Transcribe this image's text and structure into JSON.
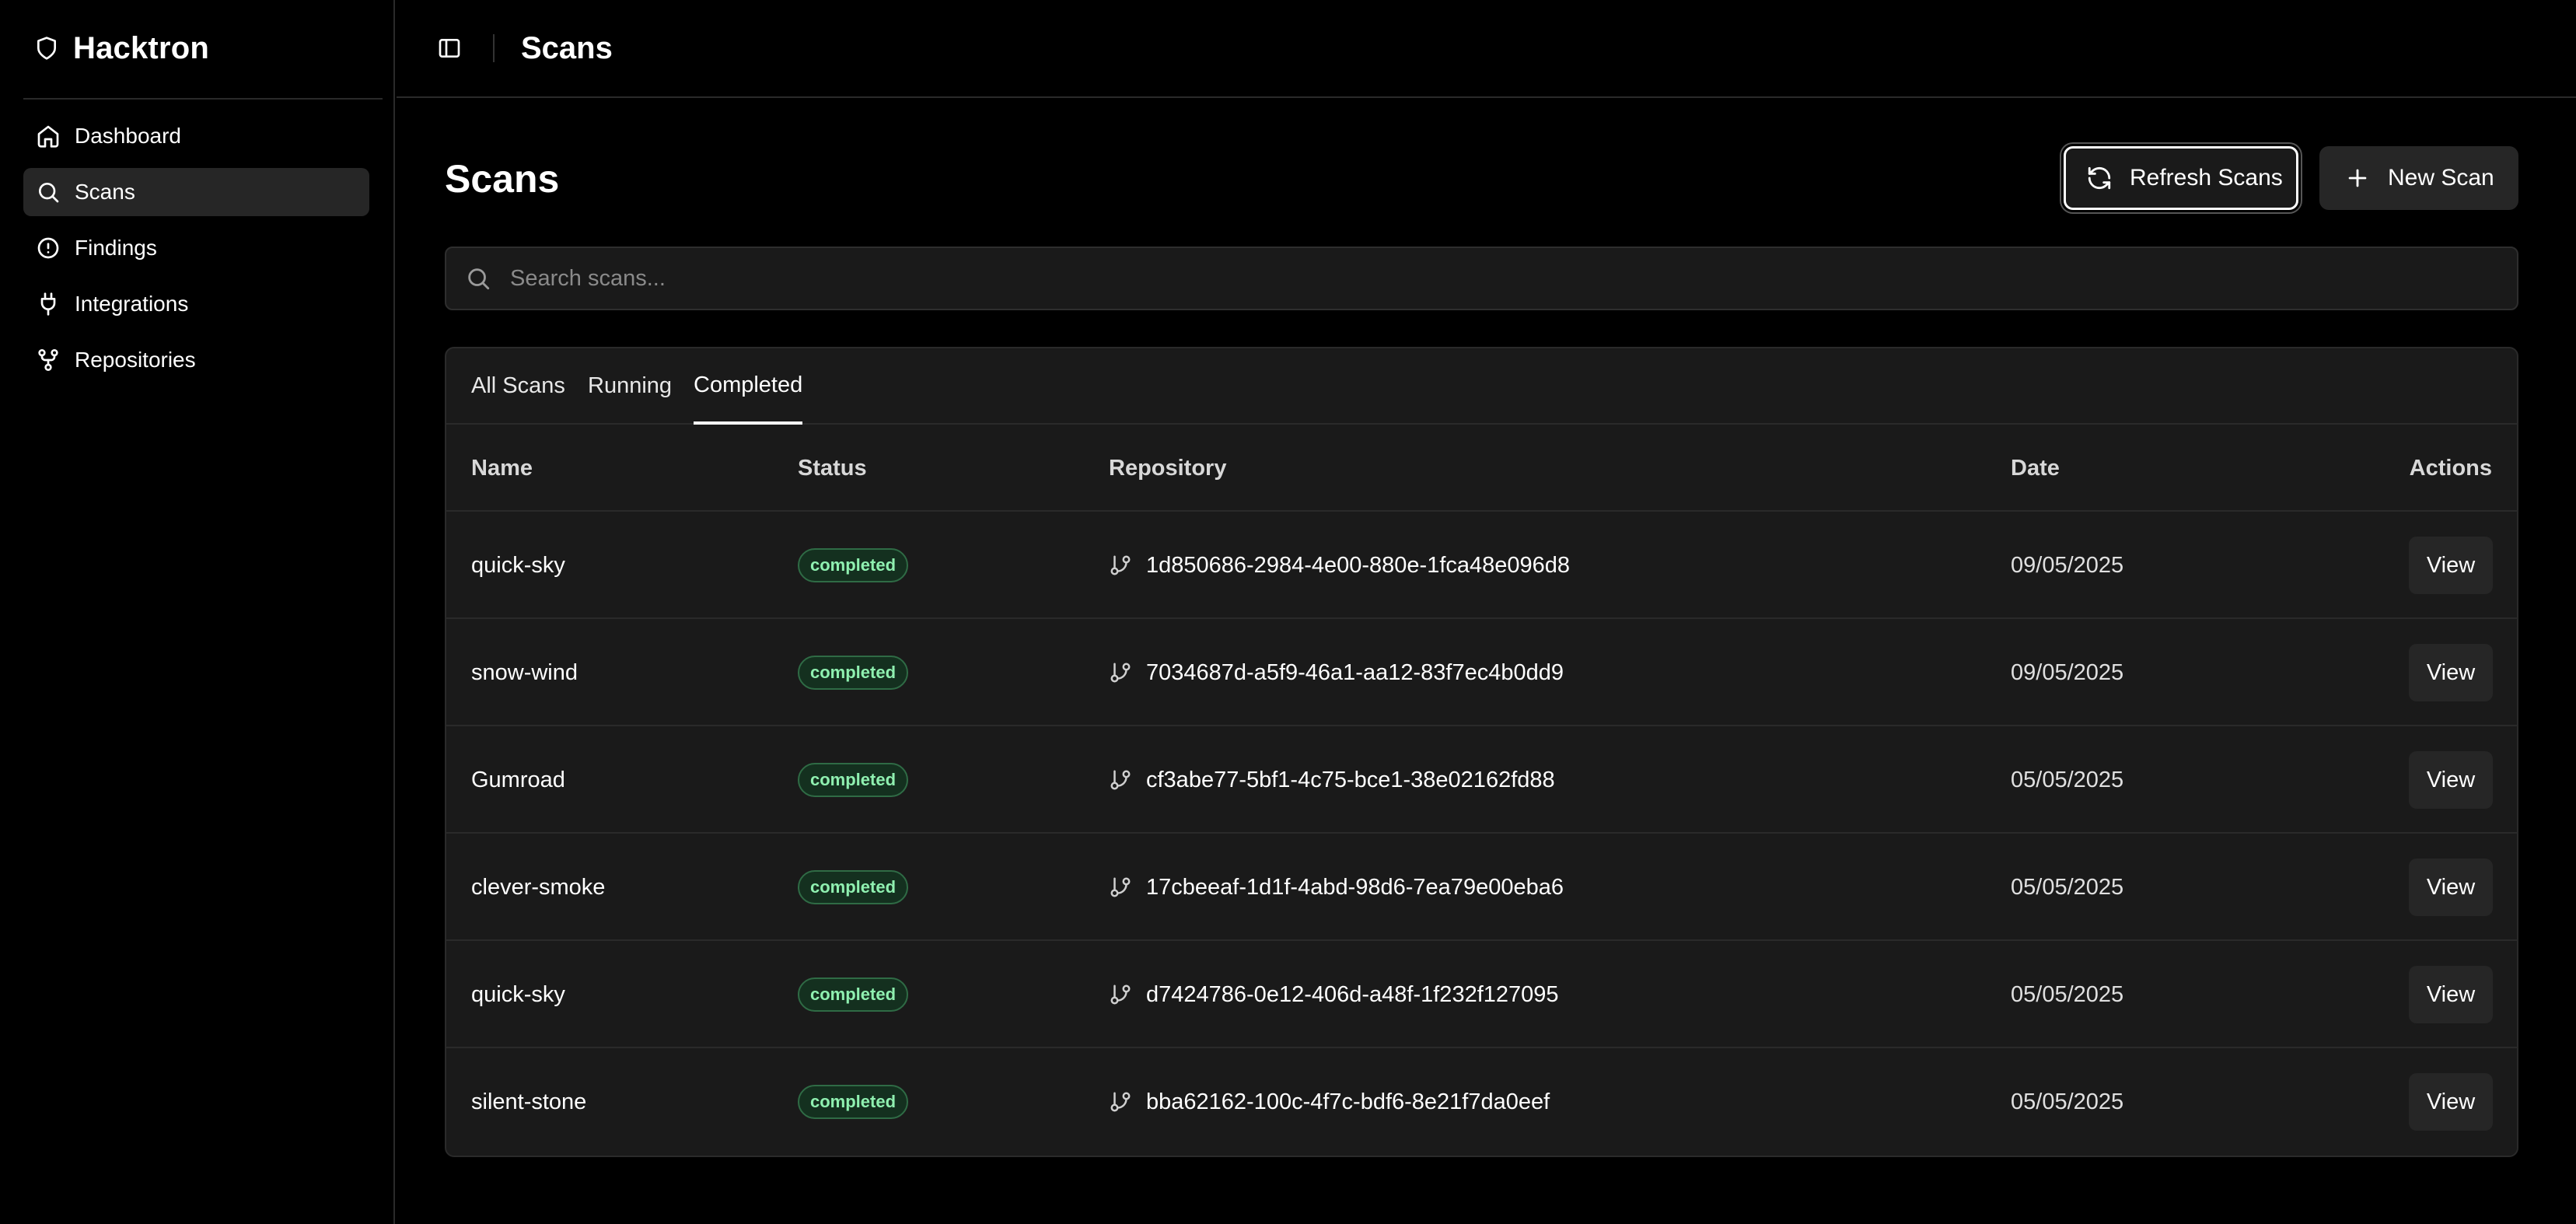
{
  "app": {
    "name": "Hacktron",
    "logo_icon": "shield-icon"
  },
  "sidebar": {
    "items": [
      {
        "label": "Dashboard",
        "icon": "home-icon",
        "active": false
      },
      {
        "label": "Scans",
        "icon": "search-icon",
        "active": true
      },
      {
        "label": "Findings",
        "icon": "alert-circle-icon",
        "active": false
      },
      {
        "label": "Integrations",
        "icon": "plug-icon",
        "active": false
      },
      {
        "label": "Repositories",
        "icon": "git-fork-icon",
        "active": false
      }
    ]
  },
  "header": {
    "title": "Scans",
    "toggle_icon": "panel-left-icon"
  },
  "main": {
    "title": "Scans",
    "refresh_label": "Refresh Scans",
    "new_scan_label": "New Scan"
  },
  "search": {
    "placeholder": "Search scans...",
    "value": ""
  },
  "tabs": [
    {
      "label": "All Scans",
      "active": false
    },
    {
      "label": "Running",
      "active": false
    },
    {
      "label": "Completed",
      "active": true
    }
  ],
  "table": {
    "columns": [
      "Name",
      "Status",
      "Repository",
      "Date",
      "Actions"
    ],
    "rows": [
      {
        "name": "quick-sky",
        "status": "completed",
        "repository": "1d850686-2984-4e00-880e-1fca48e096d8",
        "date": "09/05/2025",
        "action": "View"
      },
      {
        "name": "snow-wind",
        "status": "completed",
        "repository": "7034687d-a5f9-46a1-aa12-83f7ec4b0dd9",
        "date": "09/05/2025",
        "action": "View"
      },
      {
        "name": "Gumroad",
        "status": "completed",
        "repository": "cf3abe77-5bf1-4c75-bce1-38e02162fd88",
        "date": "05/05/2025",
        "action": "View"
      },
      {
        "name": "clever-smoke",
        "status": "completed",
        "repository": "17cbeeaf-1d1f-4abd-98d6-7ea79e00eba6",
        "date": "05/05/2025",
        "action": "View"
      },
      {
        "name": "quick-sky",
        "status": "completed",
        "repository": "d7424786-0e12-406d-a48f-1f232f127095",
        "date": "05/05/2025",
        "action": "View"
      },
      {
        "name": "silent-stone",
        "status": "completed",
        "repository": "bba62162-100c-4f7c-bdf6-8e21f7da0eef",
        "date": "05/05/2025",
        "action": "View"
      }
    ]
  },
  "colors": {
    "background": "#000000",
    "surface": "#1a1a1a",
    "badge_text": "#8ff0b0",
    "badge_bg": "#14301f"
  }
}
